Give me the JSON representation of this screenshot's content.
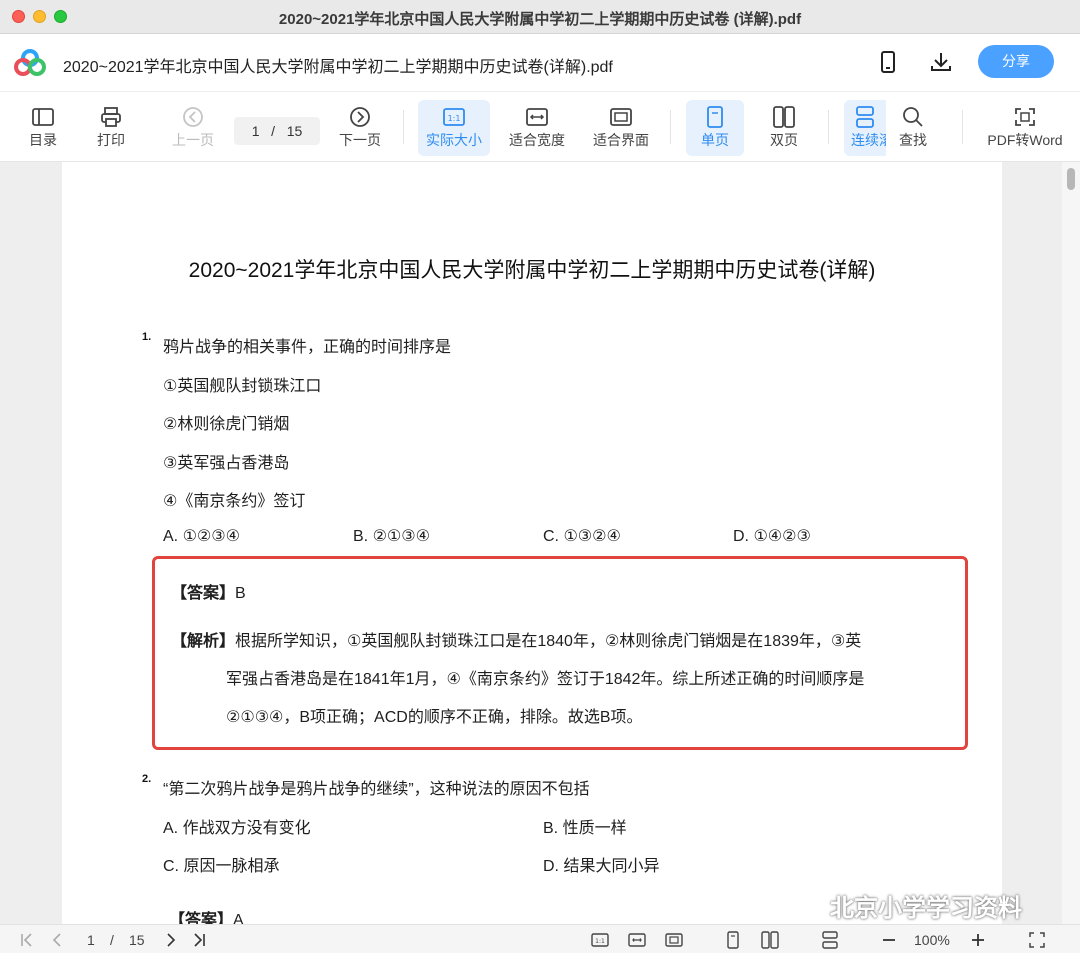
{
  "window": {
    "title": "2020~2021学年北京中国人民大学附属中学初二上学期期中历史试卷 (详解).pdf"
  },
  "app_header": {
    "file_name": "2020~2021学年北京中国人民大学附属中学初二上学期期中历史试卷(详解).pdf",
    "share_label": "分享",
    "icons": [
      "phone-icon",
      "download-icon"
    ]
  },
  "toolbar": {
    "toc": "目录",
    "print": "打印",
    "prev": "上一页",
    "page_current": "1",
    "page_sep": "/",
    "page_total": "15",
    "next": "下一页",
    "actual_size": "实际大小",
    "fit_width": "适合宽度",
    "fit_page": "适合界面",
    "single": "单页",
    "double": "双页",
    "continuous": "连续滚",
    "find": "查找",
    "pdf_to_word": "PDF转Word"
  },
  "document": {
    "title": "2020~2021学年北京中国人民大学附属中学初二上学期期中历史试卷(详解)",
    "q1": {
      "num": "1.",
      "stem": "鸦片战争的相关事件，正确的时间排序是",
      "items": [
        "①英国舰队封锁珠江口",
        "②林则徐虎门销烟",
        "③英军强占香港岛",
        "④《南京条约》签订"
      ],
      "options": [
        "A. ①②③④",
        "B. ②①③④",
        "C. ①③②④",
        "D. ①④②③"
      ],
      "answer_tag": "【答案】",
      "answer": "B",
      "analysis_tag": "【解析】",
      "analysis_lines": [
        "根据所学知识，①英国舰队封锁珠江口是在1840年，②林则徐虎门销烟是在1839年，③英",
        "军强占香港岛是在1841年1月，④《南京条约》签订于1842年。综上所述正确的时间顺序是",
        "②①③④，B项正确；ACD的顺序不正确，排除。故选B项。"
      ]
    },
    "q2": {
      "num": "2.",
      "stem": "“第二次鸦片战争是鸦片战争的继续”，这种说法的原因不包括",
      "options": [
        "A. 作战双方没有变化",
        "B. 性质一样",
        "C. 原因一脉相承",
        "D. 结果大同小异"
      ],
      "answer_tag": "【答案】",
      "answer": "A"
    }
  },
  "watermark": {
    "text": "北京小学学习资料"
  },
  "statusbar": {
    "page_current": "1",
    "page_sep": "/",
    "page_total": "15",
    "zoom": "100%"
  },
  "colors": {
    "accent": "#2e8cf0",
    "share_bg": "#4aa1ff",
    "highlight_border": "#e0443c"
  }
}
